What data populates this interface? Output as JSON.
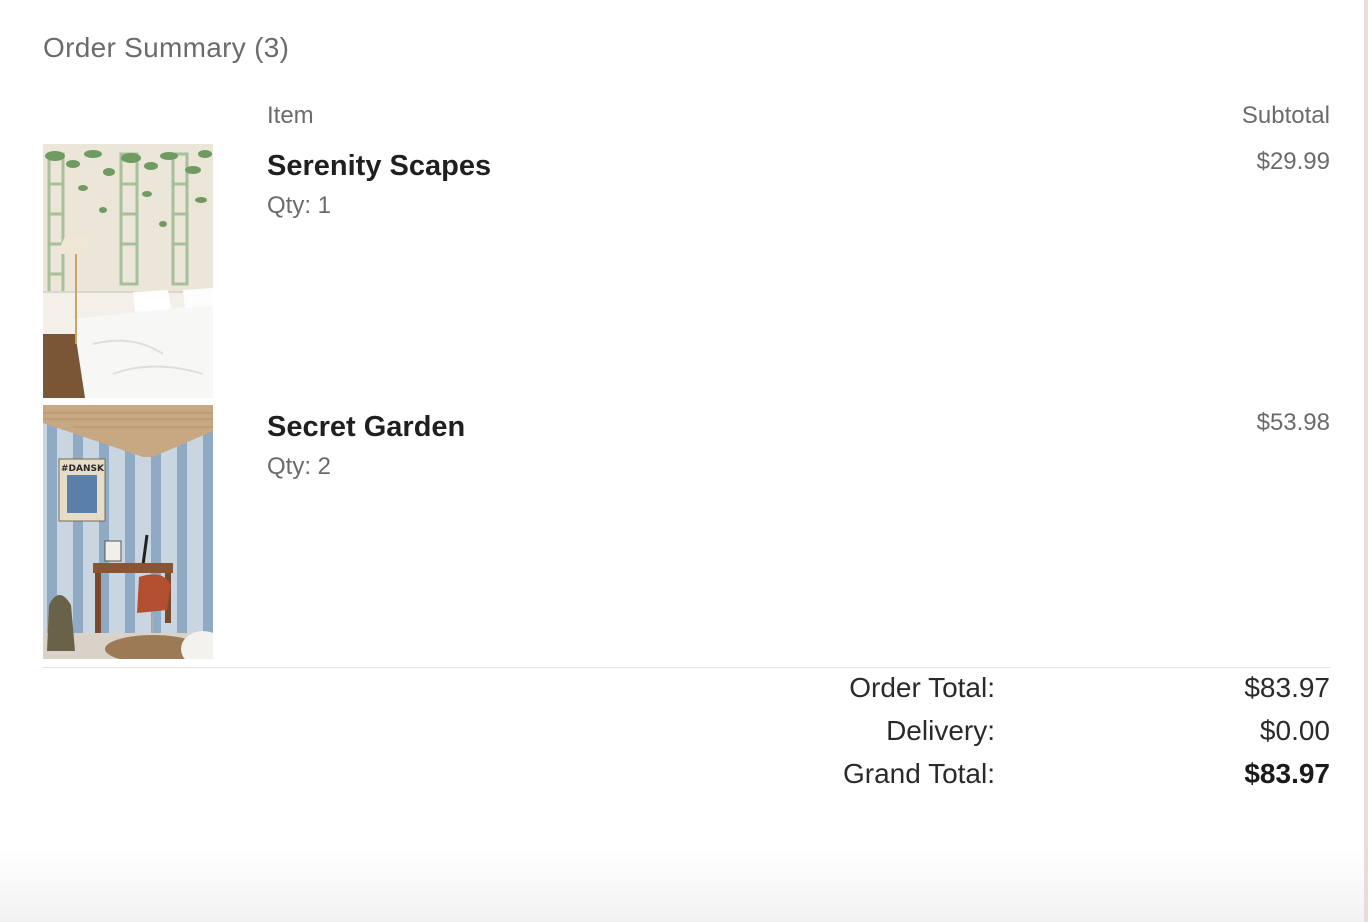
{
  "summary": {
    "title": "Order Summary (3)",
    "columns": {
      "item": "Item",
      "subtotal": "Subtotal"
    },
    "items": [
      {
        "name": "Serenity Scapes",
        "qty": "Qty: 1",
        "subtotal": "$29.99",
        "image": "bedroom-trellis-wallpaper-image"
      },
      {
        "name": "Secret Garden",
        "qty": "Qty: 2",
        "subtotal": "$53.98",
        "image": "study-vine-stripe-wallpaper-image"
      }
    ],
    "totals": {
      "order_label": "Order Total:",
      "order_value": "$83.97",
      "delivery_label": "Delivery:",
      "delivery_value": "$0.00",
      "grand_label": "Grand Total:",
      "grand_value": "$83.97"
    },
    "poster_text": "#DANSK"
  },
  "colors": {
    "title": "#6b6b6b",
    "text_dark": "#1f1f1f",
    "divider": "#e4e4e4",
    "edge": "#e9dcd4"
  }
}
